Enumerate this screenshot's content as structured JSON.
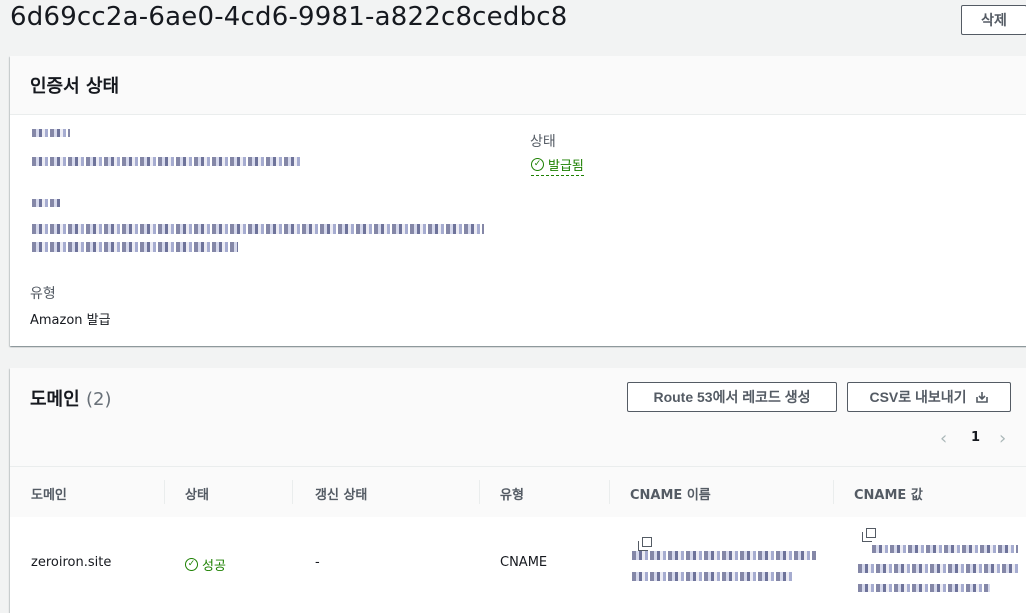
{
  "page": {
    "title": "6d69cc2a-6ae0-4cd6-9981-a822c8cedbc8",
    "delete_label": "삭제"
  },
  "status_card": {
    "heading": "인증서 상태",
    "status_label": "상태",
    "status_value": "발급됨",
    "type_label": "유형",
    "type_value": "Amazon 발급"
  },
  "domains_card": {
    "heading": "도메인",
    "count": "(2)",
    "route53_label": "Route 53에서 레코드 생성",
    "export_label": "CSV로 내보내기",
    "page_number": "1",
    "columns": [
      "도메인",
      "상태",
      "갱신 상태",
      "유형",
      "CNAME 이름",
      "CNAME 값"
    ],
    "rows": [
      {
        "domain": "zeroiron.site",
        "status": "성공",
        "renewal": "-",
        "type": "CNAME"
      }
    ]
  }
}
